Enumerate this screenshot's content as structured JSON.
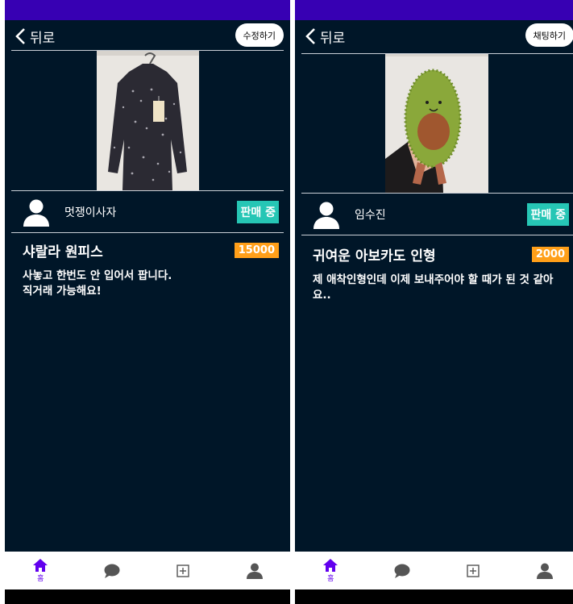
{
  "screens": [
    {
      "back_label": "뒤로",
      "action_label": "수정하기",
      "seller_name": "멋쟁이사자",
      "status": "판매 중",
      "item_title": "샤랄라 원피스",
      "price": "15000",
      "description": "사놓고 한번도 안 입어서 팝니다.\n직거래 가능해요!"
    },
    {
      "back_label": "뒤로",
      "action_label": "채팅하기",
      "seller_name": "임수진",
      "status": "판매 중",
      "item_title": "귀여운 아보카도 인형",
      "price": "2000",
      "description": "제 애착인형인데 이제 보내주어야 할 때가 된 것 같아\n요.."
    }
  ],
  "navbar": {
    "items": [
      {
        "icon": "home-icon",
        "label": "홈",
        "active": true
      },
      {
        "icon": "chat-bubble-icon",
        "label": ""
      },
      {
        "icon": "add-box-icon",
        "label": ""
      },
      {
        "icon": "person-icon",
        "label": ""
      }
    ]
  },
  "colors": {
    "background": "#001628",
    "status_bar": "#3700b3",
    "accent": "#6200ee",
    "status_badge": "#26c6b5",
    "price_badge": "#ff9f19"
  }
}
